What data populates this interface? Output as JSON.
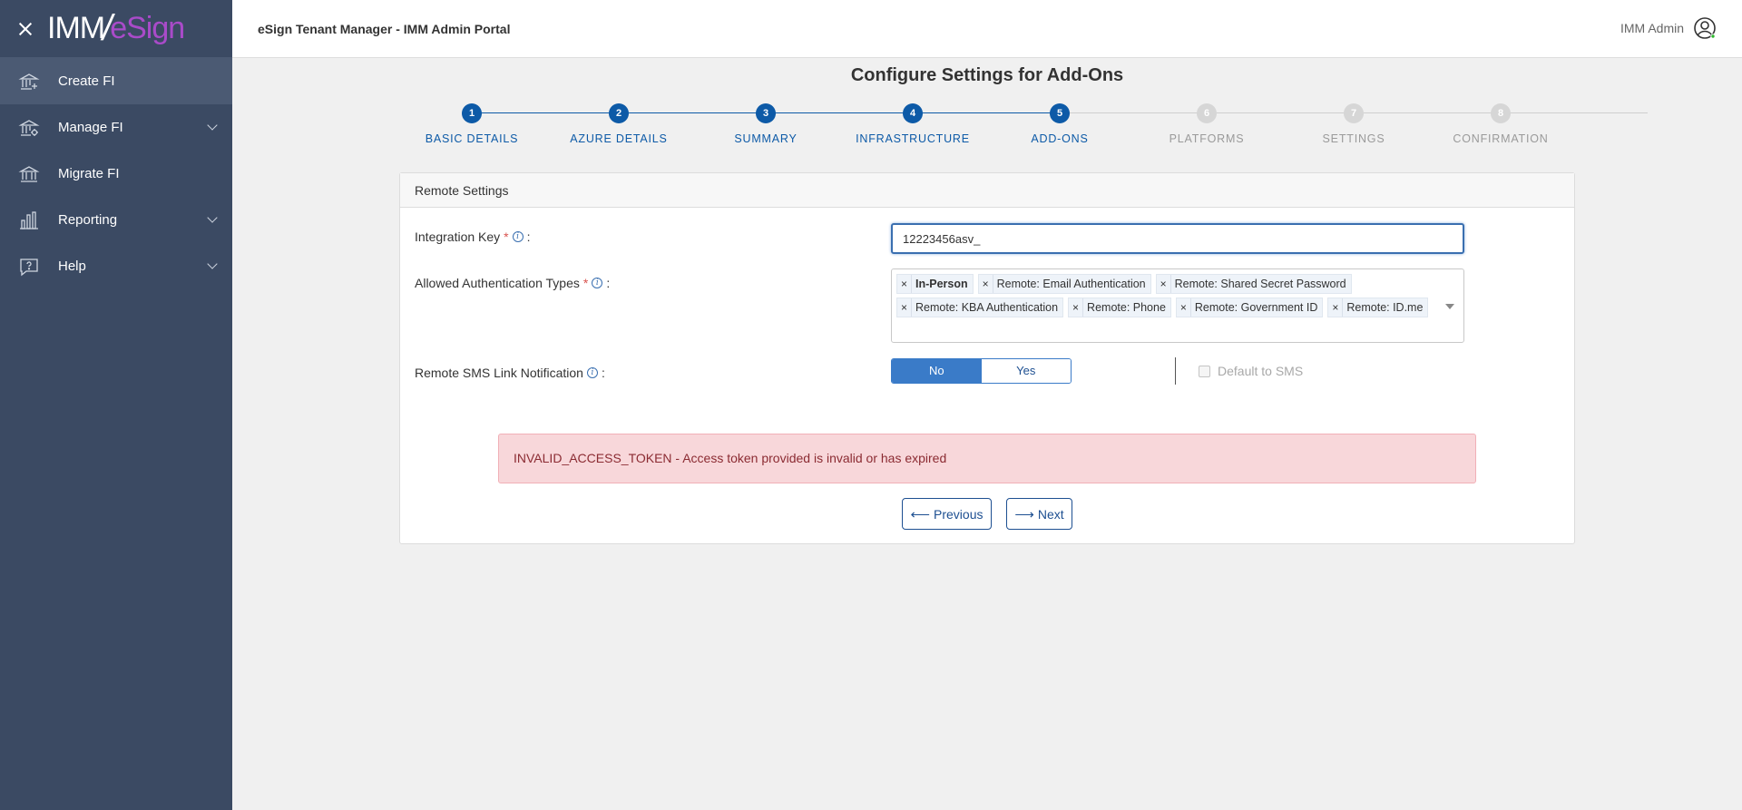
{
  "app": {
    "logo_imm": "IMM",
    "logo_slash": "/",
    "logo_esign": "eSign",
    "header_title": "eSign Tenant Manager - IMM Admin Portal",
    "user_name": "IMM Admin"
  },
  "sidebar": {
    "items": [
      {
        "label": "Create FI",
        "icon": "bank-plus-icon",
        "active": true,
        "expandable": false
      },
      {
        "label": "Manage FI",
        "icon": "bank-gear-icon",
        "active": false,
        "expandable": true
      },
      {
        "label": "Migrate FI",
        "icon": "bank-icon",
        "active": false,
        "expandable": false
      },
      {
        "label": "Reporting",
        "icon": "bar-chart-icon",
        "active": false,
        "expandable": true
      },
      {
        "label": "Help",
        "icon": "help-bubble-icon",
        "active": false,
        "expandable": true
      }
    ]
  },
  "page": {
    "title": "Configure Settings for Add-Ons"
  },
  "stepper": {
    "steps": [
      {
        "num": "1",
        "label": "BASIC DETAILS",
        "state": "done"
      },
      {
        "num": "2",
        "label": "AZURE DETAILS",
        "state": "done"
      },
      {
        "num": "3",
        "label": "SUMMARY",
        "state": "done"
      },
      {
        "num": "4",
        "label": "INFRASTRUCTURE",
        "state": "done"
      },
      {
        "num": "5",
        "label": "ADD-ONS",
        "state": "current"
      },
      {
        "num": "6",
        "label": "PLATFORMS",
        "state": "todo"
      },
      {
        "num": "7",
        "label": "SETTINGS",
        "state": "todo"
      },
      {
        "num": "8",
        "label": "CONFIRMATION",
        "state": "todo"
      }
    ]
  },
  "card": {
    "header": "Remote Settings",
    "integration_key_label": "Integration Key",
    "integration_key_value": "12223456asv_",
    "auth_types_label": "Allowed Authentication Types",
    "auth_tags_row1": [
      "In-Person",
      "Remote: Email Authentication",
      "Remote: Shared Secret Password"
    ],
    "auth_tags_row2": [
      "Remote: KBA Authentication",
      "Remote: Phone",
      "Remote: Government ID",
      "Remote: ID.me"
    ],
    "sms_label": "Remote SMS Link Notification",
    "sms_no": "No",
    "sms_yes": "Yes",
    "sms_selected": "No",
    "default_sms_label": "Default to SMS",
    "required_mark": "*",
    "colon": ":",
    "info_mark": "i",
    "remove_mark": "×"
  },
  "alert": {
    "message": "INVALID_ACCESS_TOKEN - Access token provided is invalid or has expired"
  },
  "actions": {
    "previous_label": "Previous",
    "previous_arrow": "⟵",
    "next_label": "Next",
    "next_arrow": "⟶"
  },
  "colors": {
    "sidebar_bg": "#3b4a63",
    "accent": "#0d5aa7",
    "alert_bg": "#f8d7da",
    "brand_esign": "#a94bc9"
  }
}
